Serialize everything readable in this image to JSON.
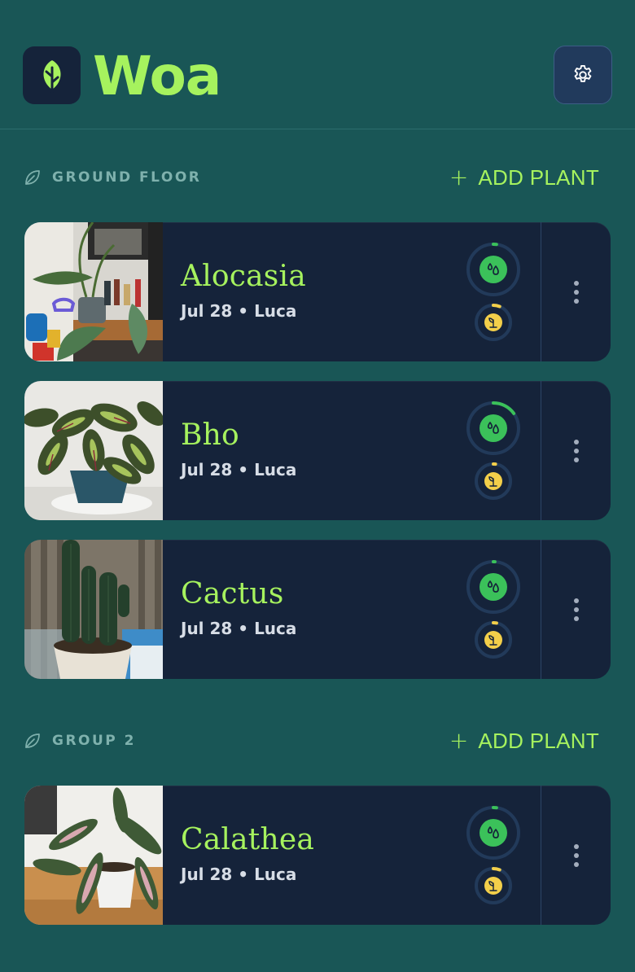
{
  "app": {
    "title": "Woa"
  },
  "colors": {
    "accent": "#a6f25e",
    "background": "#195656",
    "card": "#15233a",
    "water": "#3bc15a",
    "fertilize": "#f3cf4a"
  },
  "sections": [
    {
      "title": "GROUND FLOOR",
      "add_label": "ADD PLANT",
      "plants": [
        {
          "name": "Alocasia",
          "date": "Jul 28",
          "person": "Luca",
          "water_progress": 0.02,
          "fertilize_progress": 0.06
        },
        {
          "name": "Bho",
          "date": "Jul 28",
          "person": "Luca",
          "water_progress": 0.15,
          "fertilize_progress": 0.02
        },
        {
          "name": "Cactus",
          "date": "Jul 28",
          "person": "Luca",
          "water_progress": 0.01,
          "fertilize_progress": 0.03
        }
      ]
    },
    {
      "title": "GROUP 2",
      "add_label": "ADD PLANT",
      "plants": [
        {
          "name": "Calathea",
          "date": "Jul 28",
          "person": "Luca",
          "water_progress": 0.02,
          "fertilize_progress": 0.06
        }
      ]
    }
  ]
}
